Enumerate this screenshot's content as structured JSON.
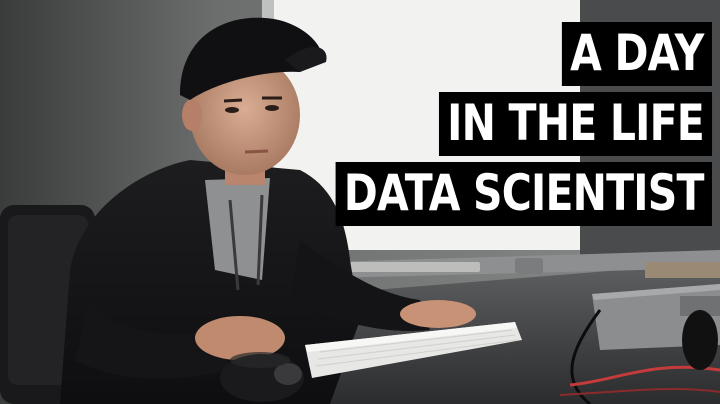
{
  "title": {
    "lines": [
      "A DAY",
      "IN THE LIFE",
      "DATA SCIENTIST"
    ]
  },
  "colors": {
    "title_background": "#000000",
    "title_text": "#ffffff"
  },
  "scene_elements": [
    "window",
    "cap",
    "hoodie",
    "keyboard",
    "mouse",
    "laptop",
    "desk",
    "office-chair",
    "cable"
  ]
}
